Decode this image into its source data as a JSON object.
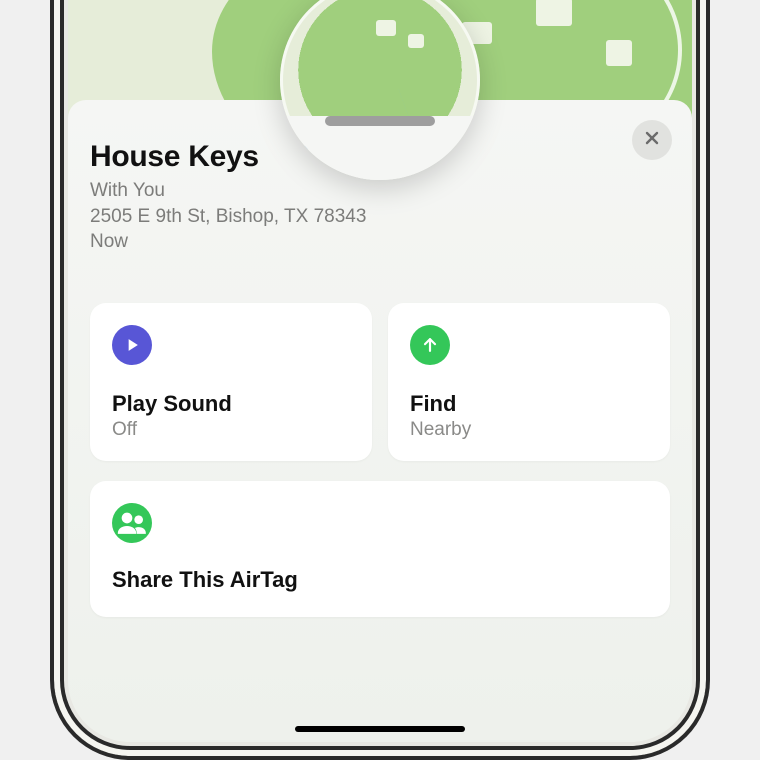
{
  "item": {
    "name": "House Keys",
    "status": "With You",
    "address": "2505 E 9th St, Bishop, TX 78343",
    "time": "Now"
  },
  "actions": {
    "play_sound": {
      "label": "Play Sound",
      "sub": "Off"
    },
    "find": {
      "label": "Find",
      "sub": "Nearby"
    },
    "share": {
      "label": "Share This AirTag"
    }
  },
  "colors": {
    "play_icon_bg": "#5856d6",
    "find_icon_bg": "#34c759",
    "share_icon_bg": "#34c759"
  }
}
